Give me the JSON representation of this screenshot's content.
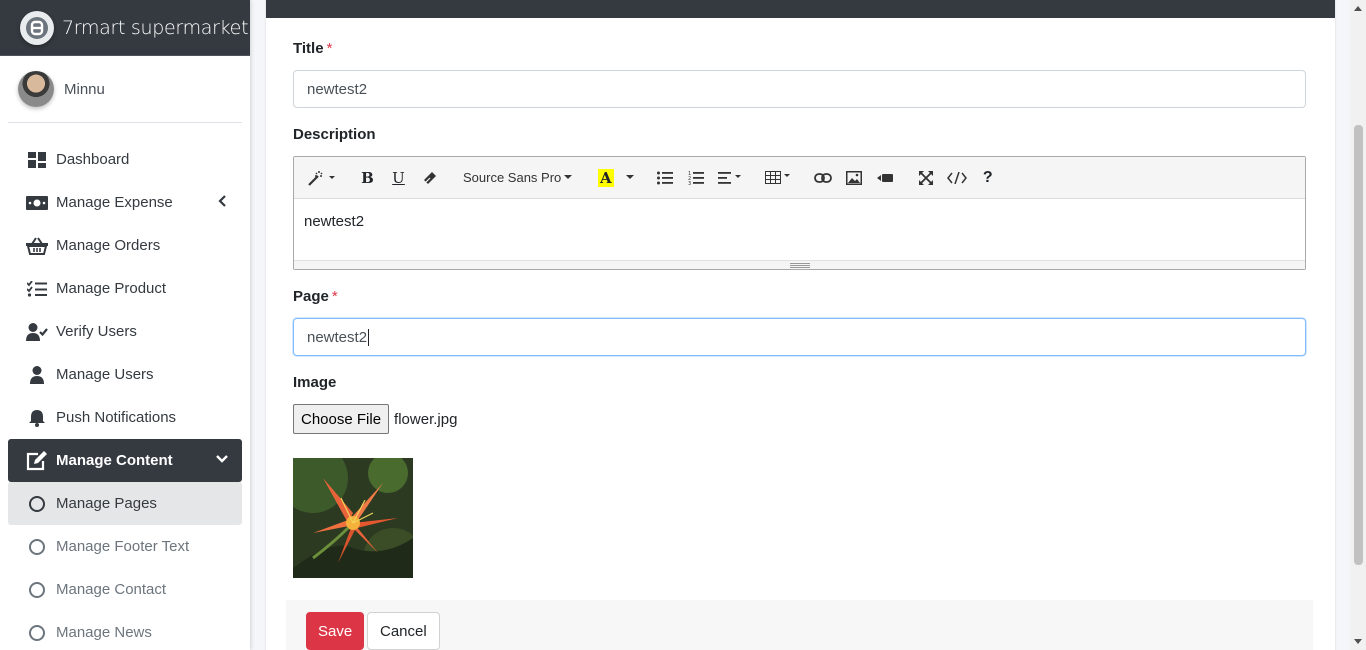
{
  "brand": {
    "name": "7rmart supermarket"
  },
  "user": {
    "name": "Minnu"
  },
  "sidebar": {
    "items": [
      {
        "label": "Dashboard",
        "icon": "dashboard-icon"
      },
      {
        "label": "Manage Expense",
        "icon": "money-icon"
      },
      {
        "label": "Manage Orders",
        "icon": "basket-icon"
      },
      {
        "label": "Manage Product",
        "icon": "tasks-icon"
      },
      {
        "label": "Verify Users",
        "icon": "user-check-icon"
      },
      {
        "label": "Manage Users",
        "icon": "user-icon"
      },
      {
        "label": "Push Notifications",
        "icon": "bell-icon"
      },
      {
        "label": "Manage Content",
        "icon": "edit-icon"
      },
      {
        "label": "Manage Pages",
        "icon": "circle-icon"
      },
      {
        "label": "Manage Footer Text",
        "icon": "circle-icon"
      },
      {
        "label": "Manage Contact",
        "icon": "circle-icon"
      },
      {
        "label": "Manage News",
        "icon": "circle-icon"
      }
    ]
  },
  "form": {
    "title_label": "Title",
    "title_value": "newtest2",
    "description_label": "Description",
    "description_value": "newtest2",
    "font_name": "Source Sans Pro",
    "page_label": "Page",
    "page_value": "newtest2",
    "image_label": "Image",
    "choose_file_label": "Choose File",
    "file_name": "flower.jpg",
    "required_mark": "*"
  },
  "footer": {
    "save_label": "Save",
    "cancel_label": "Cancel"
  },
  "colors": {
    "accent": "#dc3545",
    "dark": "#343a40",
    "focus": "#80bdff"
  }
}
